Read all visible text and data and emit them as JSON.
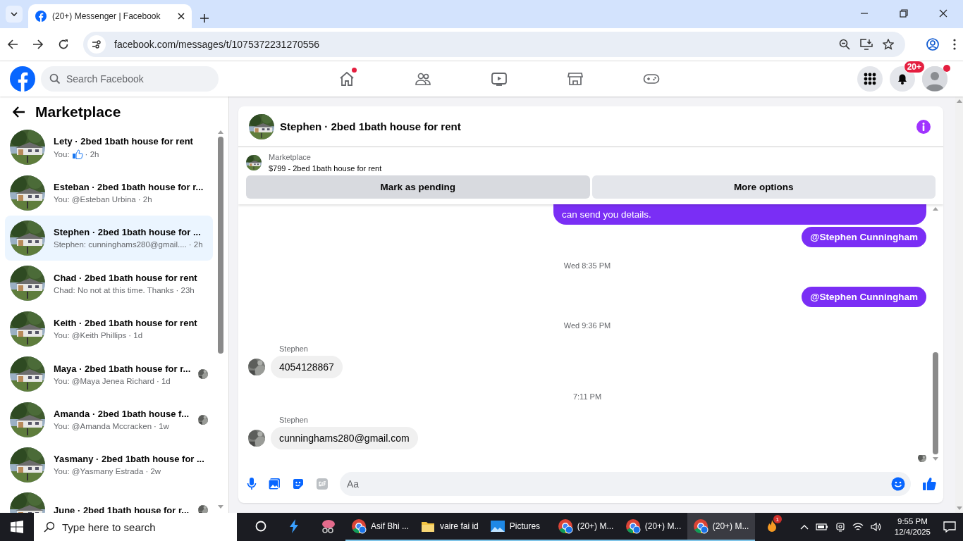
{
  "browser": {
    "tabs": [
      {
        "title": "(20+) Messenger | Facebook",
        "selected": true
      }
    ],
    "url": "facebook.com/messages/t/1075372231270556"
  },
  "fb_header": {
    "search": {
      "placeholder": "Search Facebook"
    },
    "nav": [
      {
        "kind": "home",
        "dot": true
      },
      {
        "kind": "friends",
        "dot": false
      },
      {
        "kind": "video",
        "dot": false
      },
      {
        "kind": "marketplace",
        "dot": false
      },
      {
        "kind": "gaming",
        "dot": false
      }
    ],
    "notifications_badge": "20+",
    "account_dot": true
  },
  "sidebar": {
    "title": "Marketplace",
    "conversations": [
      {
        "title": "Lety · 2bed 1bath house for rent",
        "preview": "You:",
        "liked": true,
        "time": "· 2h",
        "selected": false,
        "seen": false
      },
      {
        "title": "Esteban · 2bed 1bath house for r...",
        "preview": "You: @Esteban Urbina",
        "time": "· 2h",
        "selected": false,
        "seen": false
      },
      {
        "title": "Stephen · 2bed 1bath house for ...",
        "preview": "Stephen: cunninghams280@gmail....",
        "time": "· 2h",
        "selected": true,
        "seen": false
      },
      {
        "title": "Chad · 2bed 1bath house for rent",
        "preview": "Chad: No not at this time. Thanks",
        "time": "· 23h",
        "selected": false,
        "seen": false
      },
      {
        "title": "Keith · 2bed 1bath house for rent",
        "preview": "You: @Keith Phillips",
        "time": "· 1d",
        "selected": false,
        "seen": false
      },
      {
        "title": "Maya · 2bed 1bath house for r...",
        "preview": "You: @Maya Jenea Richard",
        "time": "· 1d",
        "selected": false,
        "seen": true
      },
      {
        "title": "Amanda · 2bed 1bath house f...",
        "preview": "You: @Amanda Mccracken",
        "time": "· 1w",
        "selected": false,
        "seen": true
      },
      {
        "title": "Yasmany · 2bed 1bath house for ...",
        "preview": "You: @Yasmany Estrada",
        "time": "· 2w",
        "selected": false,
        "seen": false
      },
      {
        "title": "June · 2bed 1bath house for r...",
        "selected": false,
        "seen": true
      }
    ]
  },
  "chat": {
    "title": "Stephen · 2bed 1bath house for rent",
    "listing": {
      "label": "Marketplace",
      "detail": "$799 - 2bed 1bath house for rent"
    },
    "buttons": [
      "Mark as pending",
      "More options"
    ],
    "messages": [
      {
        "kind": "outgoing",
        "text": "can send you details."
      },
      {
        "kind": "outgoing",
        "text": "@Stephen Cunningham",
        "bold": true
      },
      {
        "kind": "time",
        "text": "Wed 8:35 PM"
      },
      {
        "kind": "outgoing",
        "text": "@Stephen Cunningham",
        "bold": true
      },
      {
        "kind": "time",
        "text": "Wed 9:36 PM"
      },
      {
        "kind": "incoming",
        "sender": "Stephen",
        "text": "4054128867"
      },
      {
        "kind": "time",
        "text": "7:11 PM"
      },
      {
        "kind": "incoming",
        "sender": "Stephen",
        "text": "cunninghams280@gmail.com"
      },
      {
        "kind": "seen"
      }
    ],
    "composer": {
      "placeholder": "Aa"
    }
  },
  "taskbar": {
    "search": {
      "placeholder": "Type here to search"
    },
    "apps": [
      {
        "kind": "edge-ai",
        "active": false
      },
      {
        "kind": "snip",
        "active": false
      },
      {
        "kind": "chrome",
        "label": "Asif Bhi ...",
        "active": false
      },
      {
        "kind": "folder",
        "label": "vaire fai id",
        "active": false
      },
      {
        "kind": "photos",
        "label": "Pictures",
        "active": false
      },
      {
        "kind": "chrome",
        "label": "(20+) M...",
        "active": false
      },
      {
        "kind": "chrome",
        "label": "(20+) M...",
        "active": false
      },
      {
        "kind": "chrome",
        "label": "(20+) M...",
        "active": true
      },
      {
        "kind": "fire",
        "badge": "1",
        "active": false
      }
    ],
    "time": "9:55 PM",
    "date": "12/4/2025"
  }
}
